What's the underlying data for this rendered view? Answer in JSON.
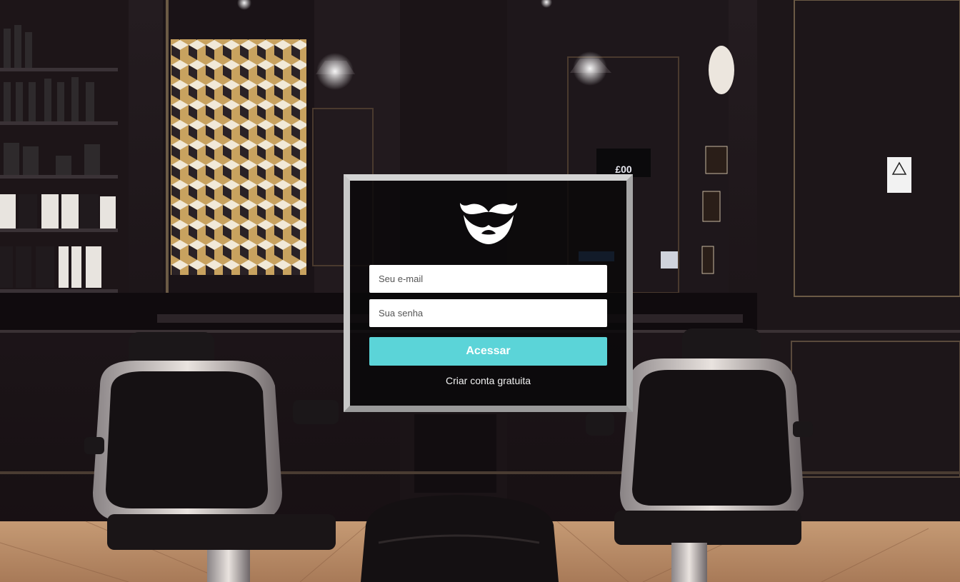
{
  "login": {
    "email_placeholder": "Seu e-mail",
    "password_placeholder": "Sua senha",
    "submit_label": "Acessar",
    "signup_link": "Criar conta gratuita",
    "logo_icon": "mustache-beard-icon"
  },
  "colors": {
    "accent": "#5bd4d8",
    "frame": "#b9b9b9",
    "panel": "#0a080a"
  }
}
